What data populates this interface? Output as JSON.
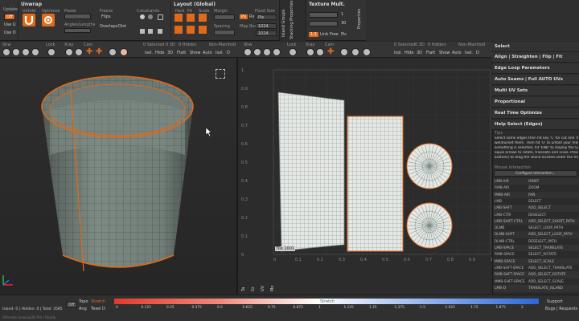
{
  "top": {
    "update_group": {
      "title": "Update",
      "off": "Off",
      "use_u": "Use U",
      "use_d": "Use D"
    },
    "unwrap": {
      "title": "Unwrap",
      "unfold": "Unfold",
      "optimize": "Optimize",
      "power": "Power",
      "freeze": "Freeze",
      "constraints": "Constraints",
      "angles_lengths": "Angles/Lengths",
      "overlaps": "Overlaps",
      "flips": "Flips",
      "dist": "Dist"
    },
    "layout": {
      "title": "Layout (Global)",
      "pack": "Pack",
      "fit": "Fit",
      "scale": "Scale",
      "margin": "Margin",
      "fixed_size": "Fixed Size",
      "spacing": "Spacing",
      "map_res": "Map Res",
      "val_pix": "Pix",
      "val_1024a": "1024",
      "val_1024b": "1024",
      "val_px": "Px",
      "val_rx": "Rx"
    },
    "vertical_tabs": [
      "Island Groups",
      "Stacking Properties",
      "Texture Mult.",
      "Properties"
    ],
    "texture": {
      "title": "Texture Mult.",
      "v1": "1",
      "v30": "30",
      "link": "Link",
      "free": "Free",
      "pic": "Pic",
      "val_11": "1:1"
    }
  },
  "toolbar2": {
    "left_items": [
      "Shw",
      "Lock",
      "Xray",
      "Cam"
    ],
    "right_items": [
      "Shw",
      "Lock",
      "Xray",
      "Cam"
    ]
  },
  "stats_bar": {
    "left": {
      "selected": "0 Selected",
      "visible": "0 3D",
      "hidden": "0 Hidden",
      "non_manifold": "Non-Manifold",
      "isol": "Isol.",
      "hide": "Hide",
      "3d": "3D",
      "flatt": "Flatt",
      "show": "Show",
      "auto": "Auto",
      "isol2": "Isol.",
      "d": "D"
    },
    "right": {
      "selected": "0 Selected",
      "visible": "0 3D",
      "hidden": "0 Hidden",
      "non_manifold": "Non-Manifold",
      "isol": "Isol.",
      "hide": "Hide",
      "3d": "3D",
      "flatt": "Flatt",
      "show": "Show",
      "auto": "Auto",
      "isol2": "Isol.",
      "d": "D"
    }
  },
  "uv_ticks_y": [
    "1",
    "0.9",
    "0.8",
    "0.7",
    "0.6",
    "0.5",
    "0.4",
    "0.3",
    "0.2",
    "0.1",
    "0"
  ],
  "uv_ticks_x": [
    "0",
    "0.1",
    "0.2",
    "0.3",
    "0.4",
    "0.5",
    "0.6",
    "0.7",
    "0.8",
    "0.9",
    "1"
  ],
  "uv_side_tabs": [
    "Ta",
    "Gr",
    "UV",
    "Mo"
  ],
  "uv_tile_label": "Tile 1001",
  "right_panel": {
    "select": "Select",
    "rows": [
      "Align | Straighten | Flip | Fit",
      "Edge Loop Parameters",
      "Auto Seams | Full AUTO UVs",
      "Multi UV Sets",
      "Proportional",
      "Real Time Optimize",
      "Help Select (Edges)"
    ],
    "tips_header": "Tips",
    "tips": [
      "Select some edges then hit key 'C' for cut and 'W' to",
      "weld/unset them. Then hit 'U' to unfold your mesh. I",
      "something is selected, hit 'ENB' to display the Gizmo",
      "equal arrows to rotate, translate and scale. Press key",
      "buttons) to drag the island located under the mouse."
    ],
    "mouse_header": "Mouse Interaction",
    "configure": "Configure Interaction...",
    "mouse": [
      [
        "LMB-AIR",
        "ORBIT"
      ],
      [
        "RMB-AIR",
        "ZOOM"
      ],
      [
        "MMB-AIR",
        "PAN"
      ],
      [
        "LMB",
        "SELECT"
      ],
      [
        "LMB-SHFT",
        "ADD_SELECT"
      ],
      [
        "LMB-CTRl",
        "DESELECT"
      ],
      [
        "LMB-SHIFT-CTRL",
        "ADD_SELECT_SHORT_PATH"
      ],
      [
        "DLMB",
        "SELECT_LOOP_PATH"
      ],
      [
        "DLMB-SHFT",
        "ADD_SELECT_LOOP_PATH"
      ],
      [
        "DLMB-CTRL",
        "DESELECT_PATH"
      ],
      [
        "LMB-SPACE",
        "SELECT_TRANSLATE"
      ],
      [
        "RMB-SPACE",
        "SELECT_ROTATE"
      ],
      [
        "MMB-SPACE",
        "SELECT_SCALE"
      ],
      [
        "LMB-SHFT-SPACE",
        "ADD_SELECT_TRANSLATE"
      ],
      [
        "RMB-SHFT-SPACE",
        "ADD_SELECT_ROTATE"
      ],
      [
        "MMB-SHFT-SPACE",
        "ADD_SELECT_SCALE"
      ],
      [
        "LMB-D",
        "TRANSLATE_ISLAND"
      ]
    ]
  },
  "bottom": {
    "status_left": "Island: 0 | Hidden: 0 | Total: 3585",
    "off": "Off",
    "topo": "Topo",
    "stretch": "Stretch",
    "ang": "Ang",
    "texel": "Texel D",
    "stretch_title": "Stretch",
    "scale": [
      "0",
      "0.125",
      "0.25",
      "0.375",
      "0.5",
      "0.625",
      "0.75",
      "0.875",
      "1",
      "1.125",
      "1.25",
      "1.375",
      "1.5",
      "1.625",
      "1.75",
      "1.875",
      "2"
    ],
    "support": "Support",
    "bugs": "Bugs | Requests",
    "footer": "Ultimate Unwrap3D Pro | Ready"
  },
  "colors": {
    "accent": "#e06a1a",
    "bg": "#2a2a2a",
    "uv_grid": "#e9e9e9",
    "mesh": "#7f8c86"
  }
}
